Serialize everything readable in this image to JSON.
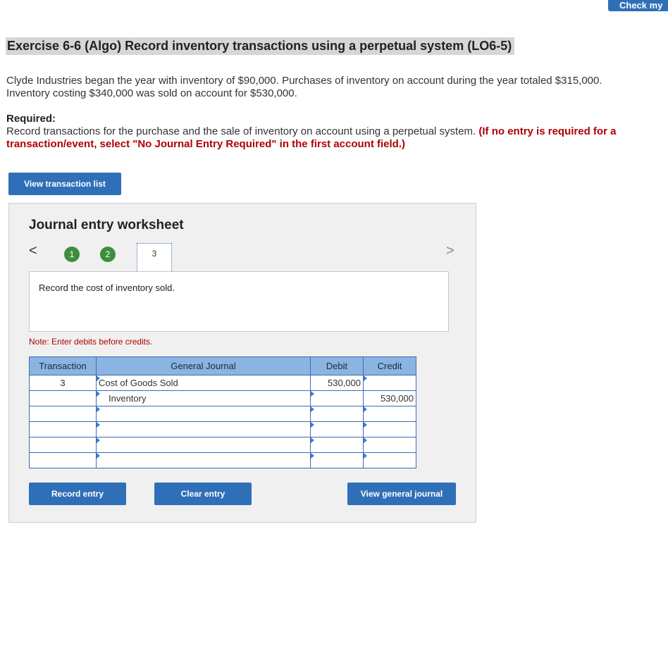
{
  "top_button": "Check my",
  "exercise_title": "Exercise 6-6 (Algo) Record inventory transactions using a perpetual system (LO6-5)",
  "problem_line1": "Clyde Industries began the year with inventory of $90,000. Purchases of inventory on account during the year totaled $315,000.",
  "problem_line2": "Inventory costing $340,000 was sold on account for $530,000.",
  "required_label": "Required:",
  "required_text": "Record transactions for the purchase and the sale of inventory on account using a perpetual system.",
  "required_note_part1": "(If no entry is required for a",
  "required_note_part2": "transaction/event, select \"No Journal Entry Required\" in the first account field.)",
  "view_transaction_list": "View transaction list",
  "worksheet": {
    "title": "Journal entry worksheet",
    "prev_arrow": "<",
    "next_arrow": ">",
    "steps": [
      "1",
      "2",
      "3"
    ],
    "description": "Record the cost of inventory sold.",
    "note": "Note: Enter debits before credits.",
    "headers": {
      "transaction": "Transaction",
      "general_journal": "General Journal",
      "debit": "Debit",
      "credit": "Credit"
    },
    "rows": [
      {
        "transaction": "3",
        "account": "Cost of Goods Sold",
        "debit": "530,000",
        "credit": ""
      },
      {
        "transaction": "",
        "account": "Inventory",
        "debit": "",
        "credit": "530,000"
      },
      {
        "transaction": "",
        "account": "",
        "debit": "",
        "credit": ""
      },
      {
        "transaction": "",
        "account": "",
        "debit": "",
        "credit": ""
      },
      {
        "transaction": "",
        "account": "",
        "debit": "",
        "credit": ""
      },
      {
        "transaction": "",
        "account": "",
        "debit": "",
        "credit": ""
      }
    ],
    "record_entry": "Record entry",
    "clear_entry": "Clear entry",
    "view_general_journal": "View general journal"
  },
  "colors": {
    "primary_button": "#2f6fb8",
    "header_bg": "#8bb4e2",
    "note_red": "#b00000",
    "step_green": "#3e8e3e"
  }
}
